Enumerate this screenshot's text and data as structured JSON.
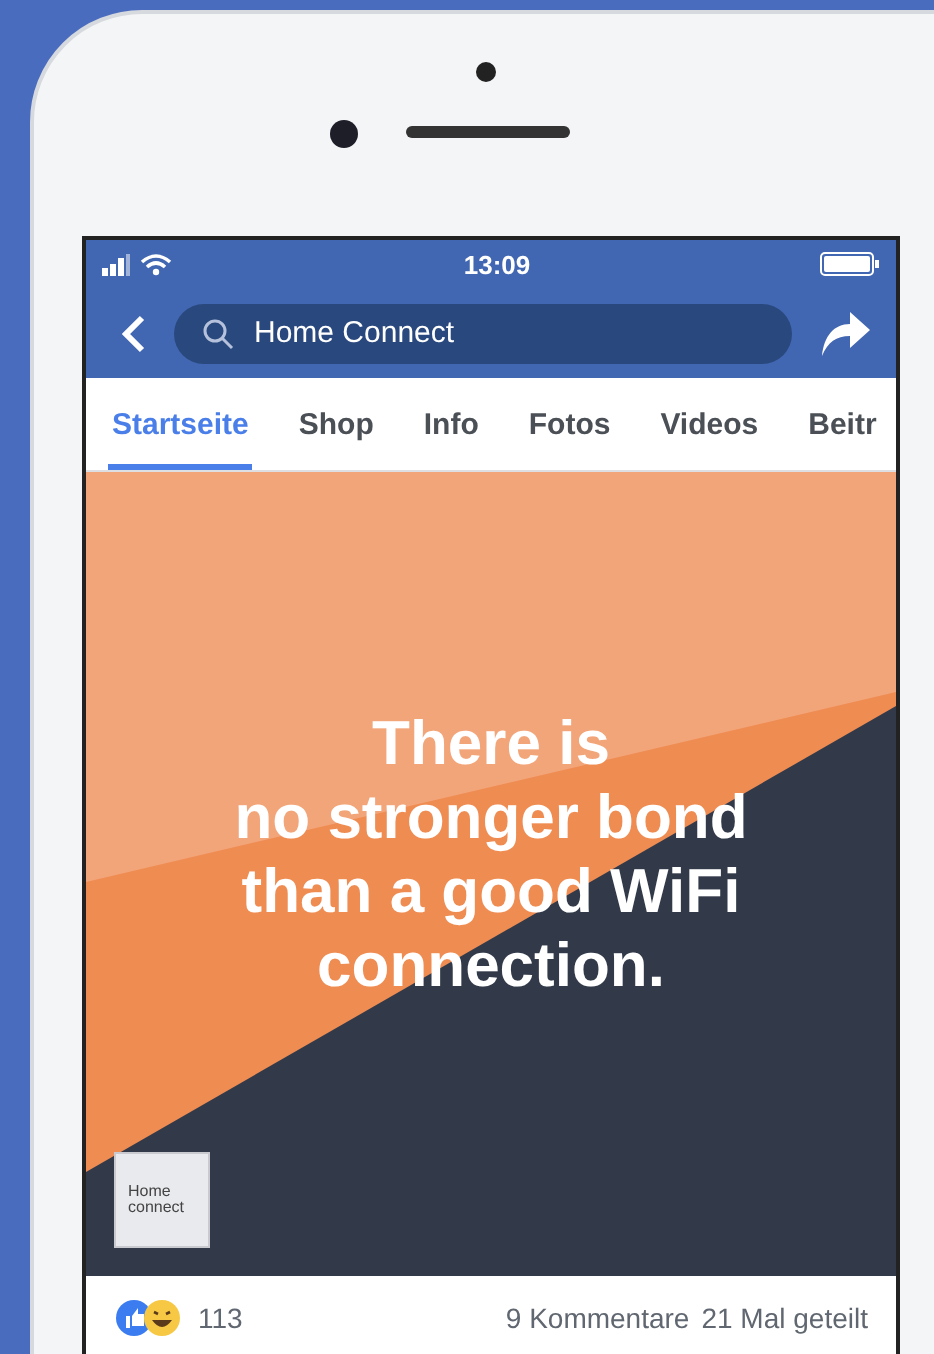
{
  "status_bar": {
    "time": "13:09"
  },
  "nav": {
    "search_value": "Home Connect"
  },
  "tabs": [
    {
      "label": "Startseite",
      "selected": true
    },
    {
      "label": "Shop",
      "selected": false
    },
    {
      "label": "Info",
      "selected": false
    },
    {
      "label": "Fotos",
      "selected": false
    },
    {
      "label": "Videos",
      "selected": false
    },
    {
      "label": "Beitr",
      "selected": false
    }
  ],
  "post": {
    "headline": "There is\nno stronger bond\nthan a good WiFi\nconnection.",
    "logo_lines": [
      "Home",
      "connect"
    ]
  },
  "footer": {
    "reactions_count": "113",
    "comments": "9 Kommentare",
    "shares": "21 Mal geteilt"
  }
}
